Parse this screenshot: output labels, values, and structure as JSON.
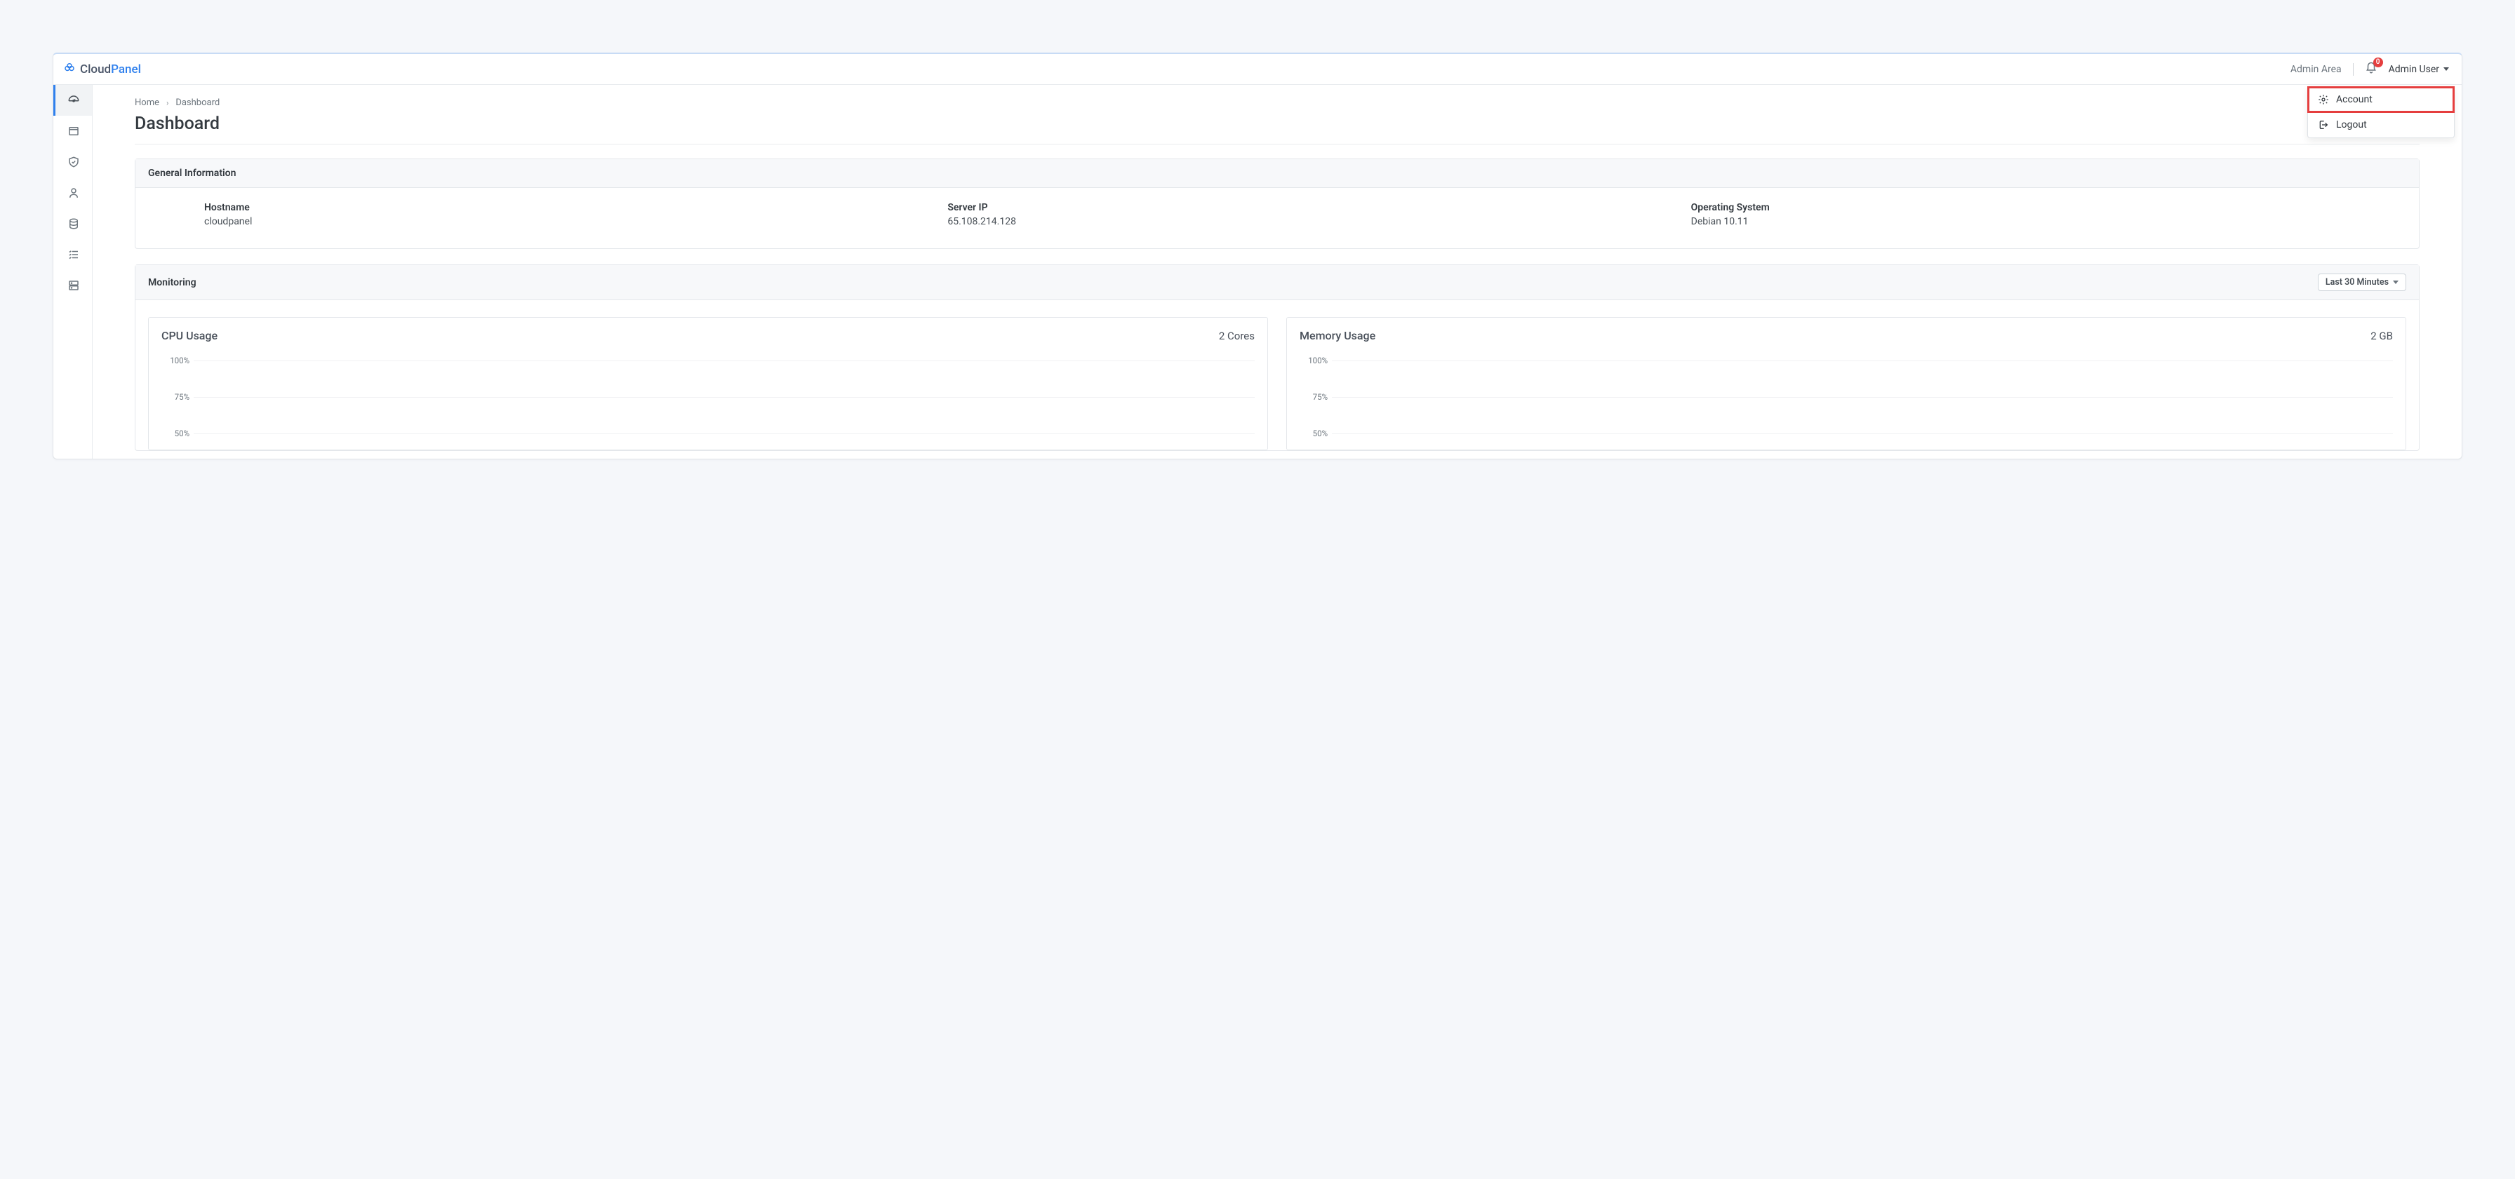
{
  "brand": {
    "part1": "Cloud",
    "part2": "Panel"
  },
  "topbar": {
    "admin_area": "Admin Area",
    "notifications_count": "0",
    "user_label": "Admin User"
  },
  "dropdown": {
    "account": "Account",
    "logout": "Logout"
  },
  "breadcrumb": {
    "home": "Home",
    "current": "Dashboard"
  },
  "page_title": "Dashboard",
  "general_info": {
    "header": "General Information",
    "hostname_label": "Hostname",
    "hostname_value": "cloudpanel",
    "serverip_label": "Server IP",
    "serverip_value": "65.108.214.128",
    "os_label": "Operating System",
    "os_value": "Debian 10.11"
  },
  "monitoring": {
    "header": "Monitoring",
    "range": "Last 30 Minutes",
    "cpu": {
      "title": "CPU Usage",
      "sub": "2 Cores"
    },
    "mem": {
      "title": "Memory Usage",
      "sub": "2 GB"
    },
    "yticks": {
      "t100": "100%",
      "t75": "75%",
      "t50": "50%"
    }
  },
  "chart_data": [
    {
      "type": "line",
      "title": "CPU Usage",
      "subtitle": "2 Cores",
      "ylabel": "%",
      "ylim": [
        0,
        100
      ],
      "yticks": [
        100,
        75,
        50
      ],
      "series": [
        {
          "name": "cpu",
          "values": []
        }
      ]
    },
    {
      "type": "line",
      "title": "Memory Usage",
      "subtitle": "2 GB",
      "ylabel": "%",
      "ylim": [
        0,
        100
      ],
      "yticks": [
        100,
        75,
        50
      ],
      "series": [
        {
          "name": "memory",
          "values": []
        }
      ]
    }
  ]
}
